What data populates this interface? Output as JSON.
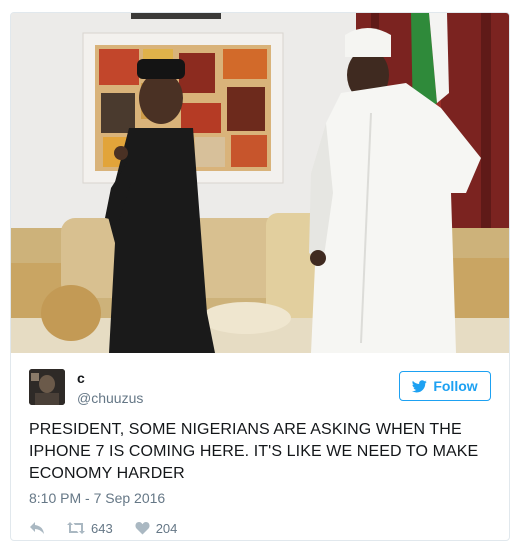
{
  "tweet": {
    "display_name": "c",
    "handle": "@chuuzus",
    "follow_label": "Follow",
    "text": "PRESIDENT, SOME NIGERIANS ARE ASKING WHEN THE IPHONE 7 IS COMING HERE. IT'S LIKE WE NEED TO MAKE ECONOMY HARDER",
    "timestamp": "8:10 PM - 7 Sep 2016",
    "retweet_count": "643",
    "like_count": "204"
  },
  "colors": {
    "accent": "#1da1f2",
    "muted_text": "#657786",
    "icon_gray": "#aab8c2"
  },
  "icons": {
    "reply": "reply-icon",
    "retweet": "retweet-icon",
    "like": "heart-icon",
    "follow": "twitter-bird-icon"
  }
}
